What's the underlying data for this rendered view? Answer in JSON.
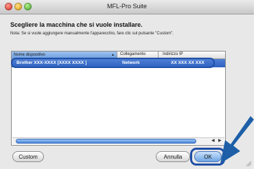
{
  "window": {
    "title": "MFL-Pro Suite"
  },
  "heading": "Scegliere la macchina che si vuole installare.",
  "note": "Nota: Se si vuole aggiungere manualmente l'apparecchio, fare clic sul pulsante \"Custom\".",
  "table": {
    "columns": [
      "Nome dispositivo",
      "Collegamento",
      "Indirizzo IP"
    ],
    "rows": [
      {
        "name": "Brother  XXX-XXXX  [XXXX XXXX ]",
        "connection": "Network",
        "ip": "XX XXX XX XXX"
      }
    ]
  },
  "buttons": {
    "custom": "Custom",
    "cancel": "Annulla",
    "ok": "OK"
  },
  "colors": {
    "selection": "#2f62c0",
    "highlight": "#1f4fa6",
    "callout": "#1e5fa8"
  }
}
